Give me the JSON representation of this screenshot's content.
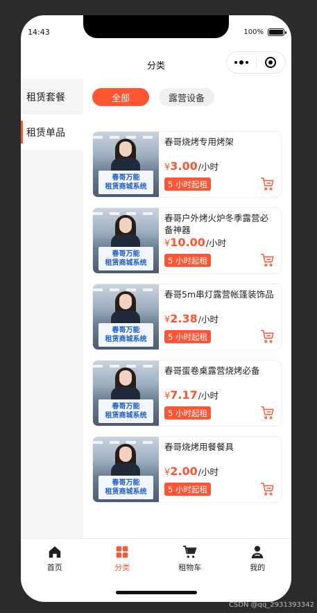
{
  "status": {
    "time": "14:43",
    "battery": "100%",
    "battery_level": 1.0
  },
  "nav": {
    "title": "分类"
  },
  "sidebar": {
    "items": [
      {
        "label": "租赁套餐",
        "active": false
      },
      {
        "label": "租赁单品",
        "active": true
      }
    ]
  },
  "filters": {
    "items": [
      {
        "label": "全部",
        "active": true
      },
      {
        "label": "露营设备",
        "active": false
      }
    ]
  },
  "products": [
    {
      "title": "春哥烧烤专用烤架",
      "currency": "¥",
      "price": "3.00",
      "unit": "/小时",
      "badge": "5 小时起租",
      "sign_line1": "春哥万能",
      "sign_line2": "租赁商城系统"
    },
    {
      "title": "春哥户外烤火炉冬季露营必备神器",
      "currency": "¥",
      "price": "10.00",
      "unit": "/小时",
      "badge": "5 小时起租",
      "sign_line1": "春哥万能",
      "sign_line2": "租赁商城系统"
    },
    {
      "title": "春哥5m串灯露营帐篷装饰品",
      "currency": "¥",
      "price": "2.38",
      "unit": "/小时",
      "badge": "5 小时起租",
      "sign_line1": "春哥万能",
      "sign_line2": "租赁商城系统"
    },
    {
      "title": "春哥蛋卷桌露营烧烤必备",
      "currency": "¥",
      "price": "7.17",
      "unit": "/小时",
      "badge": "5 小时起租",
      "sign_line1": "春哥万能",
      "sign_line2": "租赁商城系统"
    },
    {
      "title": "春哥烧烤用餐餐具",
      "currency": "¥",
      "price": "2.00",
      "unit": "/小时",
      "badge": "5 小时起租",
      "sign_line1": "春哥万能",
      "sign_line2": "租赁商城系统"
    }
  ],
  "tabbar": {
    "items": [
      {
        "label": "首页",
        "icon": "home-icon",
        "active": false
      },
      {
        "label": "分类",
        "icon": "grid-icon",
        "active": true
      },
      {
        "label": "租物车",
        "icon": "cart-icon",
        "active": false
      },
      {
        "label": "我的",
        "icon": "user-icon",
        "active": false
      }
    ]
  },
  "watermark": "CSDN @qq_2931393342",
  "colors": {
    "accent": "#ff5533",
    "sidebar_bg": "#f5f5f5",
    "background": "#2b2b2b"
  }
}
